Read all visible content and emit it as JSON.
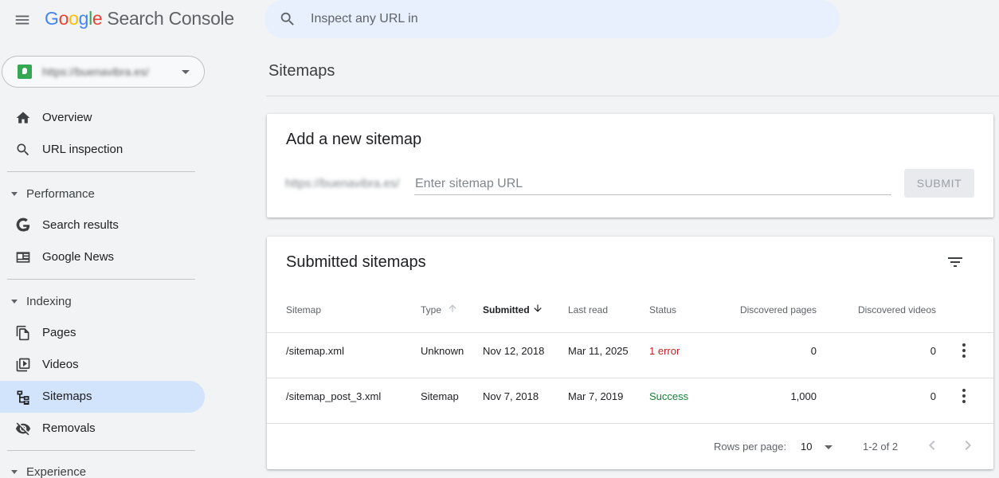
{
  "header": {
    "logo_google": "Google",
    "product_name": "Search Console",
    "search_placeholder": "Inspect any URL in"
  },
  "property": {
    "url": "https://buenavibra.es/"
  },
  "sidebar": {
    "items": [
      {
        "label": "Overview",
        "icon": "home-icon"
      },
      {
        "label": "URL inspection",
        "icon": "search-icon"
      }
    ],
    "performance": {
      "label": "Performance",
      "items": [
        {
          "label": "Search results",
          "icon": "google-g-icon"
        },
        {
          "label": "Google News",
          "icon": "news-icon"
        }
      ]
    },
    "indexing": {
      "label": "Indexing",
      "items": [
        {
          "label": "Pages",
          "icon": "pages-icon"
        },
        {
          "label": "Videos",
          "icon": "video-icon"
        },
        {
          "label": "Sitemaps",
          "icon": "sitemap-icon",
          "active": true
        },
        {
          "label": "Removals",
          "icon": "eye-off-icon"
        }
      ]
    },
    "experience": {
      "label": "Experience"
    }
  },
  "main": {
    "title": "Sitemaps",
    "add_sitemap": {
      "heading": "Add a new sitemap",
      "prefix": "https://buenavibra.es/",
      "placeholder": "Enter sitemap URL",
      "submit_label": "SUBMIT"
    },
    "submitted": {
      "heading": "Submitted sitemaps",
      "columns": {
        "sitemap": "Sitemap",
        "type": "Type",
        "submitted": "Submitted",
        "last_read": "Last read",
        "status": "Status",
        "discovered_pages": "Discovered pages",
        "discovered_videos": "Discovered videos"
      },
      "rows": [
        {
          "sitemap": "/sitemap.xml",
          "type": "Unknown",
          "submitted": "Nov 12, 2018",
          "last_read": "Mar 11, 2025",
          "status": "1 error",
          "discovered_pages": "0",
          "discovered_videos": "0"
        },
        {
          "sitemap": "/sitemap_post_3.xml",
          "type": "Sitemap",
          "submitted": "Nov 7, 2018",
          "last_read": "Mar 7, 2019",
          "status": "Success",
          "discovered_pages": "1,000",
          "discovered_videos": "0"
        }
      ],
      "footer": {
        "rows_per_page_label": "Rows per page:",
        "rows_per_page_value": "10",
        "range": "1-2 of 2"
      }
    }
  },
  "colors": {
    "accent": "#d2e3fc",
    "error": "#c5221f",
    "success": "#188038",
    "search_bg": "#e8f0fe"
  }
}
